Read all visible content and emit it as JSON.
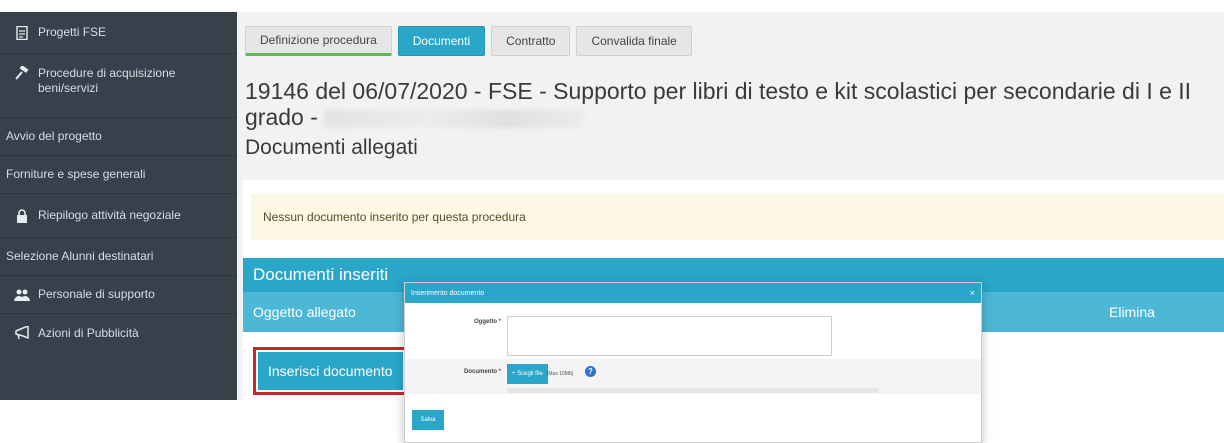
{
  "sidebar": {
    "items": [
      {
        "label": "Progetti FSE",
        "icon": "document-icon"
      },
      {
        "label": "Procedure di acquisizione beni/servizi",
        "icon": "gavel-icon"
      },
      {
        "label": "Avvio del progetto",
        "icon": ""
      },
      {
        "label": "Forniture e spese generali",
        "icon": ""
      },
      {
        "label": "Riepilogo attività negoziale",
        "icon": "lock-icon"
      },
      {
        "label": "Selezione Alunni destinatari",
        "icon": ""
      },
      {
        "label": "Personale di supporto",
        "icon": "users-icon"
      },
      {
        "label": "Azioni di Pubblicità",
        "icon": "megaphone-icon"
      }
    ]
  },
  "tabs": [
    {
      "label": "Definizione procedura",
      "state": "done"
    },
    {
      "label": "Documenti",
      "state": "active"
    },
    {
      "label": "Contratto",
      "state": "inactive"
    },
    {
      "label": "Convalida finale",
      "state": "inactive"
    }
  ],
  "page": {
    "title": "19146 del 06/07/2020 - FSE - Supporto per libri di testo e kit scolastici per secondarie di I e II grado -",
    "subtitle": "Documenti allegati"
  },
  "alert": {
    "text": "Nessun documento inserito per questa procedura"
  },
  "box": {
    "title": "Documenti inseriti",
    "col_object": "Oggetto allegato",
    "col_delete": "Elimina",
    "insert_button": "Inserisci documento"
  },
  "modal": {
    "title": "Inserimento documento",
    "close": "×",
    "object_label": "Oggetto",
    "document_label": "Documento",
    "required_mark": "*",
    "choose_file": "+ Scegli file",
    "max_size": "[Max 10Mb]",
    "help": "?",
    "save": "Salva"
  },
  "colors": {
    "accent": "#2aa6c8",
    "sidebar": "#36414c",
    "highlight": "#c9262c",
    "alert_bg": "#fcf8e3"
  }
}
